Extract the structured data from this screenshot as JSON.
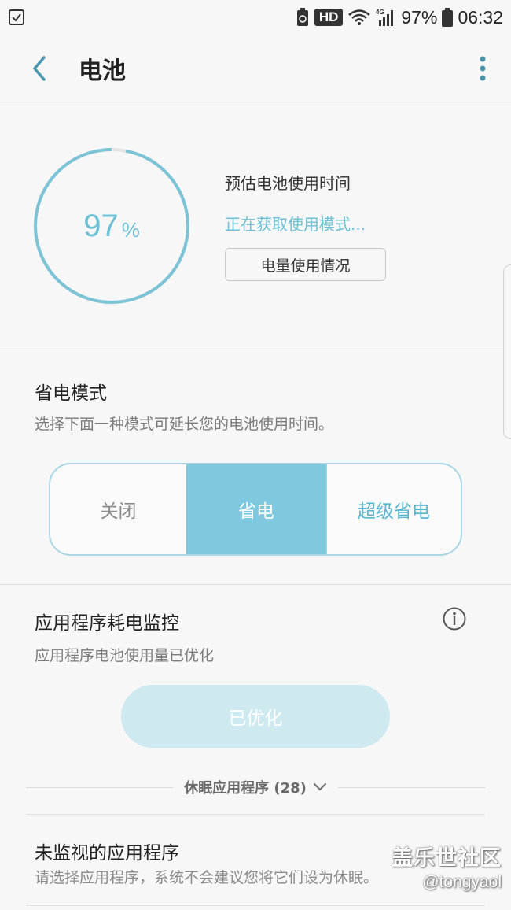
{
  "status_bar": {
    "battery_percent": "97%",
    "time": "06:32",
    "hd_badge": "HD",
    "network": "4G"
  },
  "app_bar": {
    "title": "电池"
  },
  "battery": {
    "level_number": "97",
    "level_unit": "%",
    "level_fraction": 0.97,
    "estimate_label": "预估电池使用时间",
    "estimate_status": "正在获取使用模式...",
    "usage_button_label": "电量使用情况"
  },
  "power_mode": {
    "title": "省电模式",
    "description": "选择下面一种模式可延长您的电池使用时间。",
    "options": [
      "关闭",
      "省电",
      "超级省电"
    ],
    "selected": "省电"
  },
  "app_monitor": {
    "title": "应用程序耗电监控",
    "description": "应用程序电池使用量已优化",
    "optimized_button": "已优化",
    "sleeping_apps_label": "休眠应用程序 (28)"
  },
  "unmonitored": {
    "title": "未监视的应用程序",
    "description": "请选择应用程序，系统不会建议您将它们设为休眠。"
  },
  "watermark": {
    "line1": "盖乐世社区",
    "line2": "@tongyaol"
  },
  "colors": {
    "accent": "#6cc1d4",
    "selected_mode": "#7ec9df",
    "optimized_button": "#cfe9f1"
  }
}
